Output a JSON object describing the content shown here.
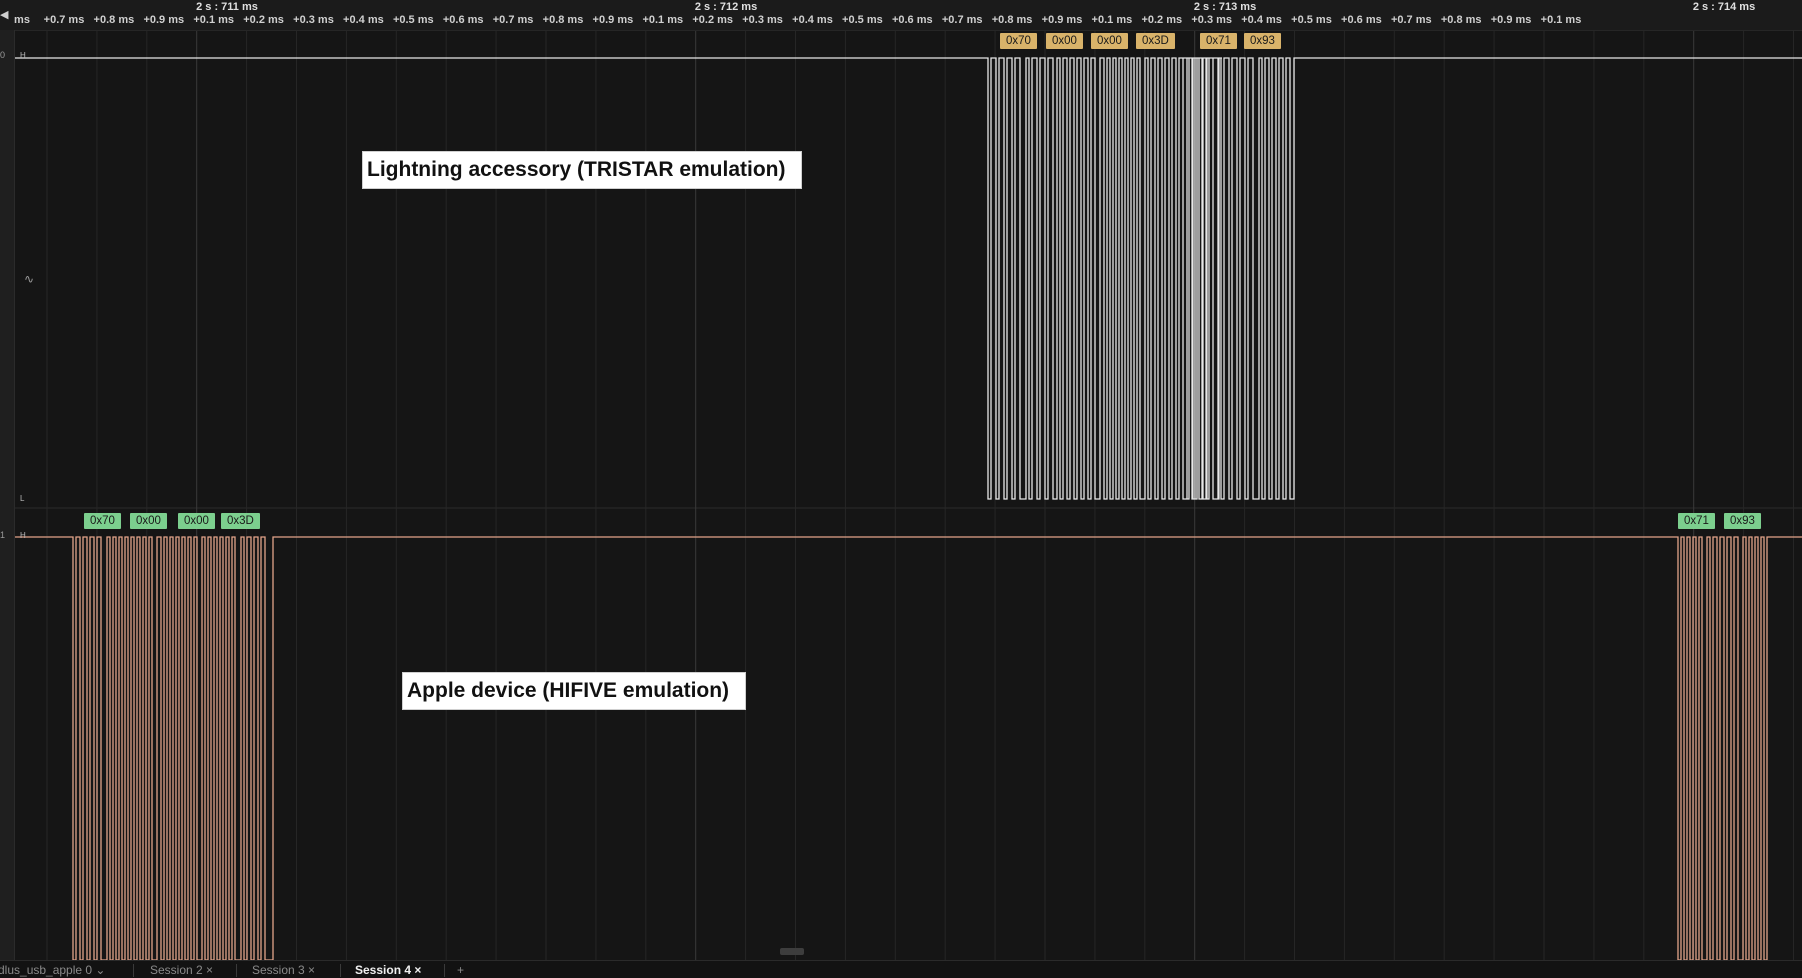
{
  "timeline": {
    "major_labels": [
      "2 s : 711 ms",
      "2 s : 712 ms",
      "2 s : 713 ms",
      "2 s : 714 ms"
    ],
    "leading_label": "ms",
    "minor_labels": [
      "+0.7 ms",
      "+0.8 ms",
      "+0.9 ms",
      "+0.1 ms",
      "+0.2 ms",
      "+0.3 ms",
      "+0.4 ms",
      "+0.5 ms",
      "+0.6 ms",
      "+0.7 ms",
      "+0.8 ms",
      "+0.9 ms",
      "+0.1 ms",
      "+0.2 ms",
      "+0.3 ms",
      "+0.4 ms",
      "+0.5 ms",
      "+0.6 ms",
      "+0.7 ms",
      "+0.8 ms",
      "+0.9 ms",
      "+0.1 ms",
      "+0.2 ms",
      "+0.3 ms",
      "+0.4 ms",
      "+0.5 ms",
      "+0.6 ms",
      "+0.7 ms",
      "+0.8 ms",
      "+0.9 ms",
      "+0.1 ms"
    ]
  },
  "channels": [
    {
      "index": "0",
      "high_marker": "H",
      "low_marker": "L",
      "glitch_marker": "∿",
      "color": "#e8e8e8",
      "annotation": "Lightning accessory (TRISTAR emulation)",
      "bytes": [
        "0x70",
        "0x00",
        "0x00",
        "0x3D",
        "0x71",
        "0x93"
      ],
      "byte_color": "#d9b36a"
    },
    {
      "index": "1",
      "high_marker": "H",
      "color": "#e3a48a",
      "annotation": "Apple device (HIFIVE emulation)",
      "bytes": [
        "0x70",
        "0x00",
        "0x00",
        "0x3D",
        "0x71",
        "0x93"
      ],
      "byte_color": "#7ccf8e"
    }
  ],
  "session_tabs": [
    {
      "label": "dlus_usb_apple 0",
      "active": false
    },
    {
      "label": "Session 2",
      "active": false
    },
    {
      "label": "Session 3",
      "active": false
    },
    {
      "label": "Session 4",
      "active": true
    }
  ],
  "add_tab_label": "+"
}
